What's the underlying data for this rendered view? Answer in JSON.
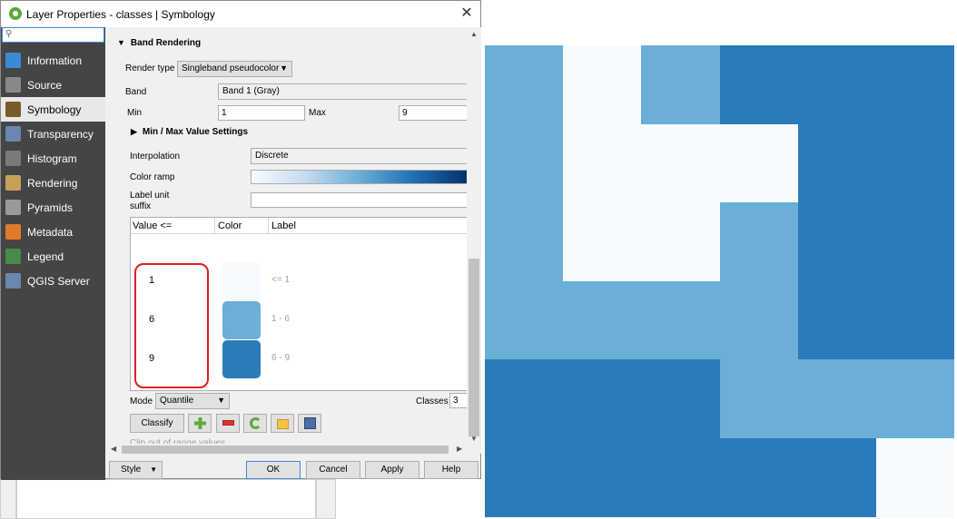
{
  "window": {
    "title": "Layer Properties - classes | Symbology",
    "close_icon": "close-icon"
  },
  "sidebar": {
    "search_placeholder": "",
    "items": [
      {
        "label": "Information",
        "icon": "information-icon"
      },
      {
        "label": "Source",
        "icon": "source-icon"
      },
      {
        "label": "Symbology",
        "icon": "symbology-icon",
        "selected": true
      },
      {
        "label": "Transparency",
        "icon": "transparency-icon"
      },
      {
        "label": "Histogram",
        "icon": "histogram-icon"
      },
      {
        "label": "Rendering",
        "icon": "rendering-icon"
      },
      {
        "label": "Pyramids",
        "icon": "pyramids-icon"
      },
      {
        "label": "Metadata",
        "icon": "metadata-icon"
      },
      {
        "label": "Legend",
        "icon": "legend-icon"
      },
      {
        "label": "QGIS Server",
        "icon": "qgis-server-icon"
      }
    ]
  },
  "band_rendering": {
    "section_title": "Band Rendering",
    "render_type_label": "Render type",
    "render_type_value": "Singleband pseudocolor",
    "band_label": "Band",
    "band_value": "Band 1 (Gray)",
    "min_label": "Min",
    "min_value": "1",
    "max_label": "Max",
    "max_value": "9",
    "minmax_section": "Min / Max Value Settings",
    "interpolation_label": "Interpolation",
    "interpolation_value": "Discrete",
    "color_ramp_label": "Color ramp",
    "label_unit_suffix_label_1": "Label unit",
    "label_unit_suffix_label_2": "suffix",
    "label_unit_suffix_value": ""
  },
  "class_table": {
    "headers": [
      "Value <=",
      "Color",
      "Label"
    ],
    "rows": [
      {
        "value": "1",
        "color": "#f7fbff",
        "label": "<= 1"
      },
      {
        "value": "6",
        "color": "#6baed6",
        "label": "1 - 6"
      },
      {
        "value": "9",
        "color": "#2b7bba",
        "label": "6 - 9"
      }
    ]
  },
  "classification": {
    "mode_label": "Mode",
    "mode_value": "Quantile",
    "classes_label": "Classes",
    "classes_value": "3",
    "classify_button": "Classify",
    "clip_label": "Clip out of range values"
  },
  "footer": {
    "style_button": "Style",
    "ok_button": "OK",
    "cancel_button": "Cancel",
    "apply_button": "Apply",
    "help_button": "Help"
  },
  "colors": {
    "light": "#f7fbff",
    "medium": "#6baed6",
    "dark": "#2b7bba",
    "highlight": "#e01e1e",
    "sidebar_bg": "#454545"
  },
  "map_grid": [
    [
      "medium",
      "light",
      "medium",
      "dark",
      "dark",
      "dark"
    ],
    [
      "medium",
      "light",
      "light",
      "light",
      "dark",
      "dark"
    ],
    [
      "medium",
      "light",
      "light",
      "medium",
      "dark",
      "dark"
    ],
    [
      "medium",
      "medium",
      "medium",
      "medium",
      "dark",
      "dark"
    ],
    [
      "dark",
      "dark",
      "dark",
      "medium",
      "medium",
      "medium"
    ],
    [
      "dark",
      "dark",
      "dark",
      "dark",
      "dark",
      "light"
    ]
  ]
}
